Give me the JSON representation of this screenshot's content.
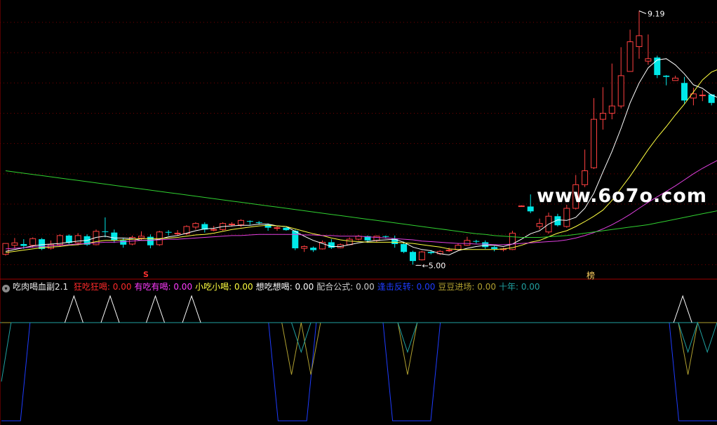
{
  "watermark": "www.6o7o.com",
  "markers": {
    "high_label": "9.19",
    "low_label": "5.00",
    "signal_s": "S",
    "signal_bang": "榜"
  },
  "indicator_legend": {
    "name": "吃肉喝血副2.1",
    "items": [
      {
        "label": "狂吃狂喝:",
        "value": "0.00",
        "color": "#ff2a2a"
      },
      {
        "label": "有吃有喝:",
        "value": "0.00",
        "color": "#ff3cff"
      },
      {
        "label": "小吃小喝:",
        "value": "0.00",
        "color": "#ffff40"
      },
      {
        "label": "想吃想喝:",
        "value": "0.00",
        "color": "#ffffff"
      },
      {
        "label": "配合公式:",
        "value": "0.00",
        "color": "#cccccc"
      },
      {
        "label": "逢击反转:",
        "value": "0.00",
        "color": "#1e3cff"
      },
      {
        "label": "豆豆进场:",
        "value": "0.00",
        "color": "#b0a030"
      },
      {
        "label": "十年:",
        "value": "0.00",
        "color": "#20a0a0"
      }
    ]
  },
  "colors": {
    "up": "#ff4040",
    "down": "#00e8e8",
    "ma_white": "#ffffff",
    "ma_yellow": "#ffff40",
    "ma_magenta": "#e040e0",
    "ma_green": "#30d030",
    "grid": "#7a0000"
  },
  "chart_data": [
    {
      "type": "candlestick",
      "title": "",
      "ylim": [
        4.9,
        9.3
      ],
      "grid": true,
      "candles": [
        [
          5.17,
          5.35,
          5.31,
          5.15
        ],
        [
          5.32,
          5.36,
          5.44,
          5.27
        ],
        [
          5.34,
          5.31,
          5.42,
          5.26
        ],
        [
          5.32,
          5.43,
          5.45,
          5.28
        ],
        [
          5.42,
          5.26,
          5.44,
          5.24
        ],
        [
          5.27,
          5.33,
          5.4,
          5.25
        ],
        [
          5.33,
          5.48,
          5.5,
          5.3
        ],
        [
          5.48,
          5.36,
          5.5,
          5.34
        ],
        [
          5.36,
          5.48,
          5.52,
          5.32
        ],
        [
          5.47,
          5.33,
          5.5,
          5.31
        ],
        [
          5.33,
          5.55,
          5.58,
          5.32
        ],
        [
          5.55,
          5.54,
          5.78,
          5.45
        ],
        [
          5.53,
          5.4,
          5.58,
          5.36
        ],
        [
          5.4,
          5.33,
          5.44,
          5.28
        ],
        [
          5.34,
          5.45,
          5.48,
          5.32
        ],
        [
          5.44,
          5.47,
          5.55,
          5.4
        ],
        [
          5.46,
          5.32,
          5.5,
          5.27
        ],
        [
          5.33,
          5.54,
          5.56,
          5.31
        ],
        [
          5.54,
          5.53,
          5.57,
          5.48
        ],
        [
          5.52,
          5.52,
          5.57,
          5.48
        ],
        [
          5.51,
          5.63,
          5.65,
          5.49
        ],
        [
          5.62,
          5.68,
          5.7,
          5.58
        ],
        [
          5.67,
          5.58,
          5.7,
          5.53
        ],
        [
          5.58,
          5.58,
          5.64,
          5.55
        ],
        [
          5.58,
          5.68,
          5.7,
          5.56
        ],
        [
          5.66,
          5.67,
          5.7,
          5.63
        ],
        [
          5.66,
          5.73,
          5.75,
          5.62
        ],
        [
          5.72,
          5.71,
          5.73,
          5.66
        ],
        [
          5.7,
          5.69,
          5.72,
          5.66
        ],
        [
          5.66,
          5.61,
          5.68,
          5.56
        ],
        [
          5.61,
          5.61,
          5.64,
          5.56
        ],
        [
          5.61,
          5.57,
          5.62,
          5.56
        ],
        [
          5.56,
          5.27,
          5.58,
          5.24
        ],
        [
          5.27,
          5.3,
          5.32,
          5.21
        ],
        [
          5.28,
          5.24,
          5.3,
          5.21
        ],
        [
          5.26,
          5.37,
          5.4,
          5.25
        ],
        [
          5.37,
          5.28,
          5.42,
          5.26
        ],
        [
          5.28,
          5.33,
          5.35,
          5.27
        ],
        [
          5.33,
          5.42,
          5.45,
          5.32
        ],
        [
          5.42,
          5.47,
          5.49,
          5.4
        ],
        [
          5.47,
          5.4,
          5.48,
          5.36
        ],
        [
          5.4,
          5.47,
          5.48,
          5.37
        ],
        [
          5.47,
          5.46,
          5.48,
          5.43
        ],
        [
          5.43,
          5.34,
          5.48,
          5.28
        ],
        [
          5.34,
          5.21,
          5.38,
          5.19
        ],
        [
          5.21,
          5.06,
          5.23,
          5.0
        ],
        [
          5.08,
          5.21,
          5.23,
          5.07
        ],
        [
          5.21,
          5.19,
          5.24,
          5.17
        ],
        [
          5.18,
          5.22,
          5.24,
          5.16
        ],
        [
          5.23,
          5.24,
          5.28,
          5.21
        ],
        [
          5.25,
          5.32,
          5.35,
          5.24
        ],
        [
          5.32,
          5.4,
          5.46,
          5.31
        ],
        [
          5.39,
          5.38,
          5.41,
          5.35
        ],
        [
          5.37,
          5.29,
          5.4,
          5.26
        ],
        [
          5.29,
          5.26,
          5.31,
          5.22
        ],
        [
          5.25,
          5.26,
          5.28,
          5.22
        ],
        [
          5.25,
          5.52,
          5.56,
          5.24
        ],
        [
          5.96,
          5.97,
          5.98,
          5.96
        ],
        [
          5.96,
          5.88,
          6.16,
          5.85
        ],
        [
          5.63,
          5.68,
          5.76,
          5.58
        ],
        [
          5.54,
          5.8,
          5.86,
          5.51
        ],
        [
          5.8,
          5.65,
          5.84,
          5.63
        ],
        [
          5.63,
          5.93,
          5.99,
          5.61
        ],
        [
          5.93,
          6.32,
          6.48,
          5.91
        ],
        [
          6.32,
          6.55,
          6.9,
          6.28
        ],
        [
          6.6,
          7.4,
          7.75,
          6.58
        ],
        [
          7.4,
          7.5,
          7.93,
          7.23
        ],
        [
          7.5,
          7.62,
          8.32,
          7.4
        ],
        [
          7.62,
          8.12,
          8.59,
          7.58
        ],
        [
          8.19,
          8.68,
          8.88,
          8.19
        ],
        [
          8.6,
          8.78,
          9.19,
          8.4
        ],
        [
          8.36,
          8.4,
          8.8,
          8.3
        ],
        [
          8.42,
          8.13,
          8.45,
          8.08
        ],
        [
          8.12,
          8.1,
          8.13,
          7.96
        ],
        [
          8.04,
          8.08,
          8.12,
          8.04
        ],
        [
          8.0,
          7.71,
          8.1,
          7.66
        ],
        [
          7.75,
          7.82,
          7.92,
          7.63
        ],
        [
          7.8,
          7.8,
          7.88,
          7.7
        ],
        [
          7.81,
          7.67,
          7.82,
          7.63
        ],
        [
          7.66,
          7.6,
          7.9,
          7.58
        ],
        [
          7.4,
          7.17,
          7.45,
          7.12
        ],
        [
          7.15,
          7.0,
          7.23,
          6.9
        ],
        [
          7.15,
          7.12,
          7.26,
          6.98
        ]
      ],
      "ma_lines": [
        {
          "name": "MA5",
          "values": [
            5.22,
            5.25,
            5.28,
            5.31,
            5.33,
            5.34,
            5.35,
            5.37,
            5.39,
            5.4,
            5.45,
            5.47,
            5.44,
            5.44,
            5.43,
            5.4,
            5.4,
            5.42,
            5.46,
            5.48,
            5.52,
            5.56,
            5.59,
            5.6,
            5.63,
            5.64,
            5.65,
            5.65,
            5.67,
            5.67,
            5.64,
            5.63,
            5.55,
            5.47,
            5.4,
            5.35,
            5.3,
            5.3,
            5.33,
            5.36,
            5.38,
            5.4,
            5.41,
            5.42,
            5.37,
            5.29,
            5.25,
            5.23,
            5.18,
            5.16,
            5.23,
            5.27,
            5.3,
            5.32,
            5.32,
            5.3,
            5.34,
            5.42,
            5.51,
            5.56,
            5.67,
            5.74,
            5.73,
            5.78,
            5.93,
            6.18,
            6.53,
            6.87,
            7.25,
            7.67,
            8.0,
            8.25,
            8.38,
            8.4,
            8.3,
            8.15,
            7.97,
            7.91,
            7.8,
            7.74,
            7.62,
            7.45,
            7.26
          ]
        },
        {
          "name": "MA10",
          "values": [
            5.2,
            5.22,
            5.24,
            5.26,
            5.28,
            5.29,
            5.3,
            5.32,
            5.33,
            5.35,
            5.38,
            5.4,
            5.4,
            5.41,
            5.42,
            5.43,
            5.43,
            5.43,
            5.44,
            5.45,
            5.47,
            5.49,
            5.5,
            5.52,
            5.55,
            5.58,
            5.6,
            5.62,
            5.64,
            5.65,
            5.64,
            5.63,
            5.59,
            5.55,
            5.51,
            5.48,
            5.44,
            5.41,
            5.39,
            5.38,
            5.37,
            5.37,
            5.37,
            5.37,
            5.36,
            5.35,
            5.33,
            5.31,
            5.29,
            5.26,
            5.25,
            5.25,
            5.25,
            5.25,
            5.25,
            5.26,
            5.28,
            5.32,
            5.37,
            5.4,
            5.46,
            5.52,
            5.56,
            5.63,
            5.71,
            5.8,
            5.9,
            6.06,
            6.26,
            6.46,
            6.68,
            6.9,
            7.1,
            7.28,
            7.47,
            7.65,
            7.85,
            8.05,
            8.18,
            8.24,
            8.24,
            8.18,
            8.08
          ]
        },
        {
          "name": "MA30",
          "values": [
            5.26,
            5.27,
            5.28,
            5.29,
            5.3,
            5.31,
            5.32,
            5.33,
            5.34,
            5.35,
            5.36,
            5.37,
            5.37,
            5.38,
            5.39,
            5.4,
            5.4,
            5.41,
            5.42,
            5.42,
            5.43,
            5.44,
            5.45,
            5.46,
            5.47,
            5.48,
            5.48,
            5.49,
            5.5,
            5.5,
            5.5,
            5.5,
            5.5,
            5.49,
            5.49,
            5.48,
            5.48,
            5.47,
            5.47,
            5.47,
            5.46,
            5.45,
            5.44,
            5.43,
            5.42,
            5.41,
            5.39,
            5.38,
            5.37,
            5.36,
            5.35,
            5.35,
            5.34,
            5.34,
            5.33,
            5.33,
            5.34,
            5.35,
            5.36,
            5.37,
            5.38,
            5.39,
            5.41,
            5.44,
            5.48,
            5.53,
            5.59,
            5.66,
            5.74,
            5.83,
            5.93,
            6.03,
            6.12,
            6.21,
            6.3,
            6.4,
            6.5,
            6.59,
            6.67,
            6.75,
            6.83,
            6.9,
            6.97
          ]
        },
        {
          "name": "MA120",
          "values": [
            6.55,
            6.53,
            6.51,
            6.49,
            6.47,
            6.45,
            6.43,
            6.41,
            6.39,
            6.37,
            6.35,
            6.33,
            6.31,
            6.29,
            6.27,
            6.25,
            6.23,
            6.21,
            6.19,
            6.17,
            6.15,
            6.13,
            6.11,
            6.09,
            6.07,
            6.05,
            6.03,
            6.01,
            5.99,
            5.97,
            5.95,
            5.93,
            5.91,
            5.89,
            5.87,
            5.85,
            5.83,
            5.81,
            5.79,
            5.77,
            5.75,
            5.73,
            5.71,
            5.69,
            5.67,
            5.65,
            5.63,
            5.61,
            5.59,
            5.57,
            5.55,
            5.53,
            5.51,
            5.5,
            5.48,
            5.47,
            5.46,
            5.45,
            5.45,
            5.45,
            5.46,
            5.47,
            5.48,
            5.5,
            5.52,
            5.54,
            5.56,
            5.58,
            5.6,
            5.62,
            5.64,
            5.66,
            5.69,
            5.72,
            5.75,
            5.78,
            5.81,
            5.84,
            5.87,
            5.9,
            5.93,
            5.96,
            5.98
          ]
        }
      ]
    },
    {
      "type": "line",
      "title": "吃肉喝血副2.1",
      "spikes_white": [
        6,
        10,
        15,
        19,
        68
      ],
      "series": [
        {
          "name": "逢击反转",
          "values": [
            0.0,
            0.0,
            0.0,
            100,
            100,
            100,
            100,
            100,
            100,
            100,
            100,
            100,
            100,
            100,
            100,
            100,
            100,
            100,
            100,
            100,
            100,
            100,
            100,
            100,
            100,
            100,
            100,
            100,
            100,
            0.0,
            0.0,
            0.0,
            0.0,
            100,
            100,
            100,
            100,
            100,
            100,
            100,
            100,
            0.0,
            0.0,
            0.0,
            0.0,
            0.0,
            100,
            100,
            100,
            100,
            100,
            100,
            100,
            100,
            100,
            100,
            100,
            100,
            100,
            100,
            100,
            100,
            100,
            100,
            100,
            100,
            100,
            100,
            100,
            100,
            100,
            0.0,
            0.0,
            0.0,
            0.0,
            0.0
          ]
        },
        {
          "name": "豆豆进场",
          "values": [
            100,
            100,
            100,
            100,
            100,
            100,
            100,
            100,
            100,
            100,
            100,
            100,
            100,
            100,
            100,
            100,
            100,
            100,
            100,
            100,
            100,
            100,
            100,
            100,
            100,
            100,
            100,
            100,
            100,
            100,
            47,
            100,
            47,
            100,
            100,
            100,
            100,
            100,
            100,
            100,
            100,
            100,
            47,
            100,
            100,
            100,
            100,
            100,
            100,
            100,
            100,
            100,
            100,
            100,
            100,
            100,
            100,
            100,
            100,
            100,
            100,
            100,
            100,
            100,
            100,
            100,
            100,
            100,
            100,
            100,
            100,
            47,
            100,
            100,
            100
          ]
        },
        {
          "name": "十年",
          "values": [
            40,
            100,
            100,
            100,
            100,
            100,
            100,
            100,
            100,
            100,
            100,
            100,
            100,
            100,
            100,
            100,
            100,
            100,
            100,
            100,
            100,
            100,
            100,
            100,
            100,
            100,
            100,
            100,
            100,
            100,
            100,
            70,
            100,
            100,
            100,
            100,
            100,
            100,
            100,
            100,
            100,
            100,
            70,
            100,
            100,
            100,
            100,
            100,
            100,
            100,
            100,
            100,
            100,
            100,
            100,
            100,
            100,
            100,
            100,
            100,
            100,
            100,
            100,
            100,
            100,
            100,
            100,
            100,
            100,
            100,
            100,
            70,
            100,
            70,
            100
          ]
        }
      ]
    }
  ]
}
